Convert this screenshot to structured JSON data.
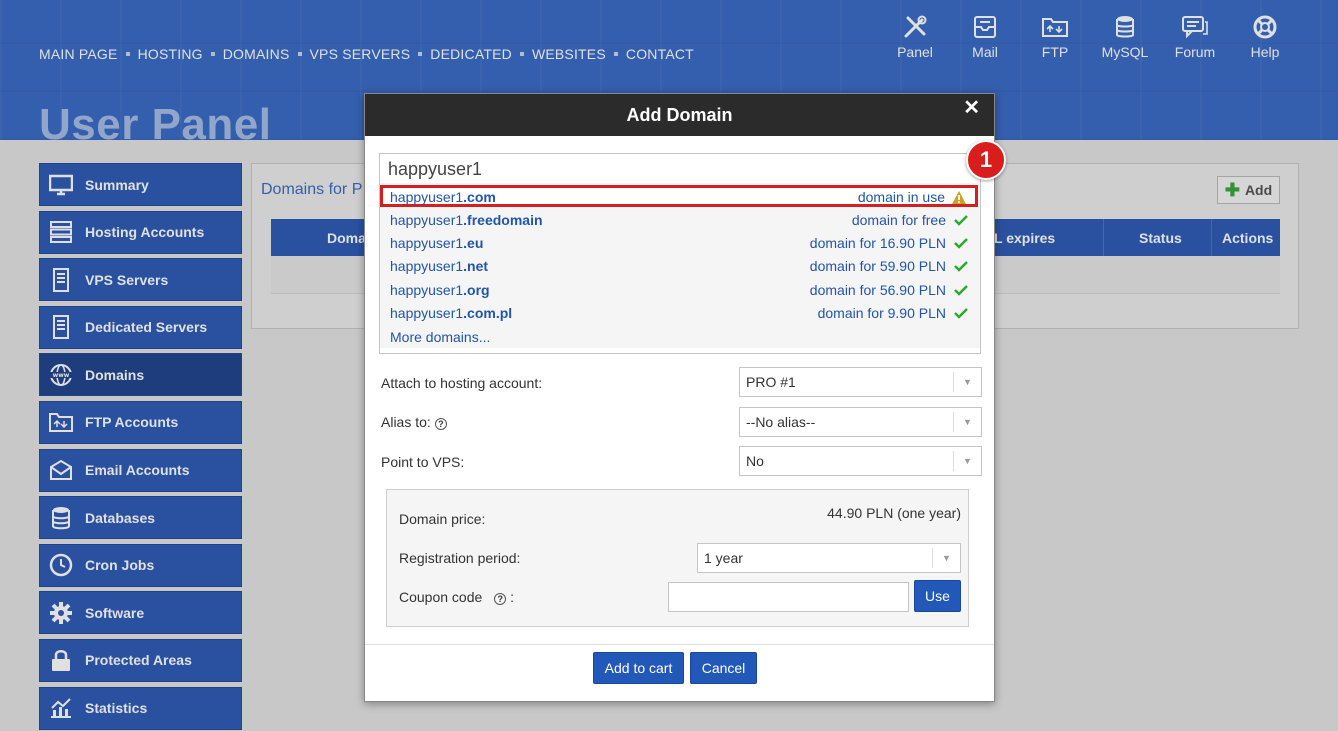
{
  "nav": {
    "items": [
      "MAIN PAGE",
      "HOSTING",
      "DOMAINS",
      "VPS SERVERS",
      "DEDICATED",
      "WEBSITES",
      "CONTACT"
    ]
  },
  "toolbar": {
    "items": [
      {
        "label": "Panel",
        "icon": "tools-icon"
      },
      {
        "label": "Mail",
        "icon": "mail-icon"
      },
      {
        "label": "FTP",
        "icon": "ftp-folder-icon"
      },
      {
        "label": "MySQL",
        "icon": "database-icon"
      },
      {
        "label": "Forum",
        "icon": "forum-icon"
      },
      {
        "label": "Help",
        "icon": "lifebuoy-icon"
      }
    ]
  },
  "page": {
    "title": "User Panel"
  },
  "sidebar": {
    "items": [
      {
        "label": "Summary",
        "icon": "monitor-icon",
        "active": false
      },
      {
        "label": "Hosting Accounts",
        "icon": "server-icon",
        "active": false
      },
      {
        "label": "VPS Servers",
        "icon": "vps-icon",
        "active": false
      },
      {
        "label": "Dedicated Servers",
        "icon": "dedicated-server-icon",
        "active": false
      },
      {
        "label": "Domains",
        "icon": "www-globe-icon",
        "active": true
      },
      {
        "label": "FTP Accounts",
        "icon": "ftp-folder-icon",
        "active": false
      },
      {
        "label": "Email Accounts",
        "icon": "envelope-icon",
        "active": false
      },
      {
        "label": "Databases",
        "icon": "database-icon",
        "active": false
      },
      {
        "label": "Cron Jobs",
        "icon": "clock-icon",
        "active": false
      },
      {
        "label": "Software",
        "icon": "gear-icon",
        "active": false
      },
      {
        "label": "Protected Areas",
        "icon": "lock-icon",
        "active": false
      },
      {
        "label": "Statistics",
        "icon": "chart-icon",
        "active": false
      }
    ]
  },
  "content": {
    "title": "Domains for P",
    "add_label": "Add",
    "columns": [
      "Doma",
      "L expires",
      "Status",
      "Actions"
    ]
  },
  "modal": {
    "title": "Add Domain",
    "close": "✕",
    "search_value": "happyuser1",
    "results": [
      {
        "name": "happyuser1",
        "tld": ".com",
        "status": "domain in use",
        "available": false
      },
      {
        "name": "happyuser1",
        "tld": ".freedomain",
        "status": "domain for free",
        "available": true
      },
      {
        "name": "happyuser1",
        "tld": ".eu",
        "status": "domain for 16.90 PLN",
        "available": true
      },
      {
        "name": "happyuser1",
        "tld": ".net",
        "status": "domain for 59.90 PLN",
        "available": true
      },
      {
        "name": "happyuser1",
        "tld": ".org",
        "status": "domain for 56.90 PLN",
        "available": true
      },
      {
        "name": "happyuser1",
        "tld": ".com.pl",
        "status": "domain for 9.90 PLN",
        "available": true
      }
    ],
    "more_domains": "More domains...",
    "badge": "1",
    "attach_label": "Attach to hosting account:",
    "attach_value": "PRO #1",
    "alias_label": "Alias to:",
    "alias_value": "--No alias--",
    "vps_label": "Point to VPS:",
    "vps_value": "No",
    "price_label": "Domain price:",
    "price_value": "44.90 PLN (one year)",
    "period_label": "Registration period:",
    "period_value": "1 year",
    "coupon_label": "Coupon code",
    "coupon_suffix": ":",
    "use_label": "Use",
    "add_to_cart_label": "Add to cart",
    "cancel_label": "Cancel"
  },
  "colors": {
    "brand_blue": "#2f5db6",
    "header_blue": "#3b6dc7",
    "highlight_red": "#d42020",
    "ok_green": "#2ea82e",
    "warn_yellow": "#c9a227"
  }
}
